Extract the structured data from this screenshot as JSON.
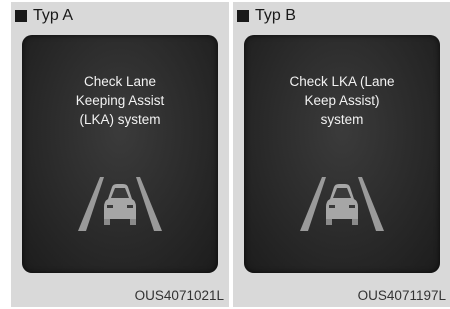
{
  "panels": [
    {
      "header": "Typ A",
      "message_lines": [
        "Check Lane",
        "Keeping Assist",
        "(LKA) system"
      ],
      "code": "OUS4071021L",
      "icons": {
        "header": "square-icon",
        "graphic": "lane-keeping-car-icon"
      }
    },
    {
      "header": "Typ B",
      "message_lines": [
        "Check LKA (Lane",
        "Keep Assist)",
        "system"
      ],
      "code": "OUS4071197L",
      "icons": {
        "header": "square-icon",
        "graphic": "lane-keeping-car-icon"
      }
    }
  ],
  "colors": {
    "panel_background": "#d9d9d9",
    "screen_background": "#2a2a2a",
    "screen_text": "#f2f2f2",
    "header_text": "#1a1a1a"
  }
}
